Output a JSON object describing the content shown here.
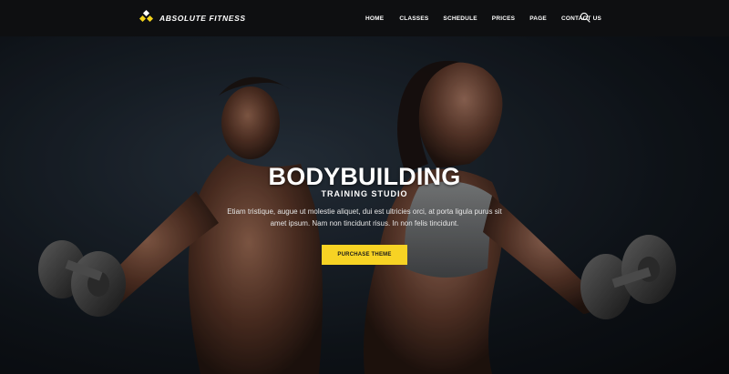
{
  "brand": {
    "name": "ABSOLUTE FITNESS",
    "accent_color": "#f7d324"
  },
  "nav": {
    "items": [
      {
        "label": "HOME"
      },
      {
        "label": "CLASSES"
      },
      {
        "label": "SCHEDULE"
      },
      {
        "label": "PRICES"
      },
      {
        "label": "PAGE"
      },
      {
        "label": "CONTACT US"
      }
    ],
    "search_icon": "search-icon"
  },
  "hero": {
    "title": "BODYBUILDING",
    "subtitle": "TRAINING STUDIO",
    "text": "Etiam tristique, augue ut molestie aliquet, dui est ultricies orci, at porta ligula purus sit amet ipsum. Nam non tincidunt risus. In non felis tincidunt.",
    "cta_label": "PURCHASE THEME",
    "image": "man and woman bodybuilders holding dumbbells"
  }
}
